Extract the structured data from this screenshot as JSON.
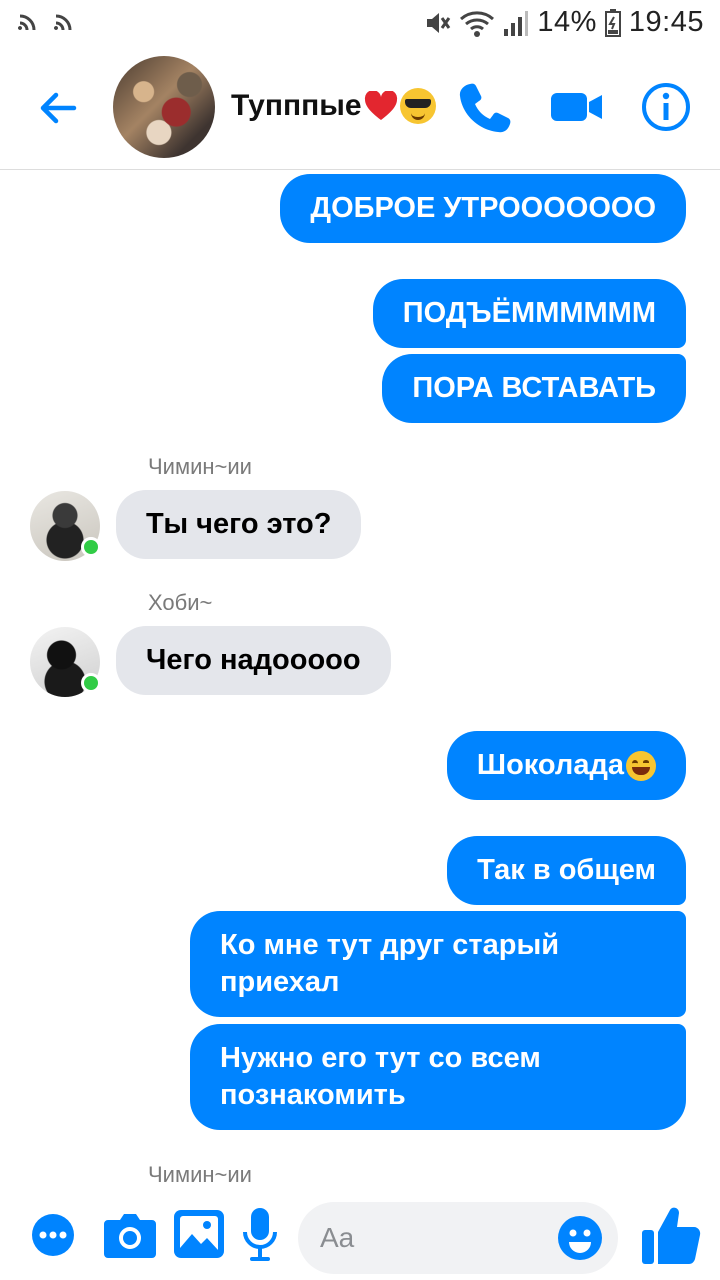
{
  "status_bar": {
    "battery": "14%",
    "time": "19:45"
  },
  "header": {
    "title": "Тупппые"
  },
  "messages": {
    "m1": "ДОБРОЕ УТРООООООО",
    "m2": "ПОДЪЁММММММ",
    "m3": "ПОРА ВСТАВАТЬ",
    "sender1": "Чимин~ии",
    "m4": "Ты чего это?",
    "sender2": "Хоби~",
    "m5": "Чего надооооо",
    "m6": "Шоколада",
    "m7": "Так в общем",
    "m8_line1": "Ко мне тут друг старый",
    "m8_line2": "приехал",
    "m9_line1": "Нужно его тут со всем",
    "m9_line2": "познакомить",
    "sender3": "Чимин~ии"
  },
  "composer": {
    "placeholder": "Aa"
  },
  "colors": {
    "accent": "#0084ff",
    "incoming": "#e4e6eb",
    "online": "#31cc46"
  }
}
